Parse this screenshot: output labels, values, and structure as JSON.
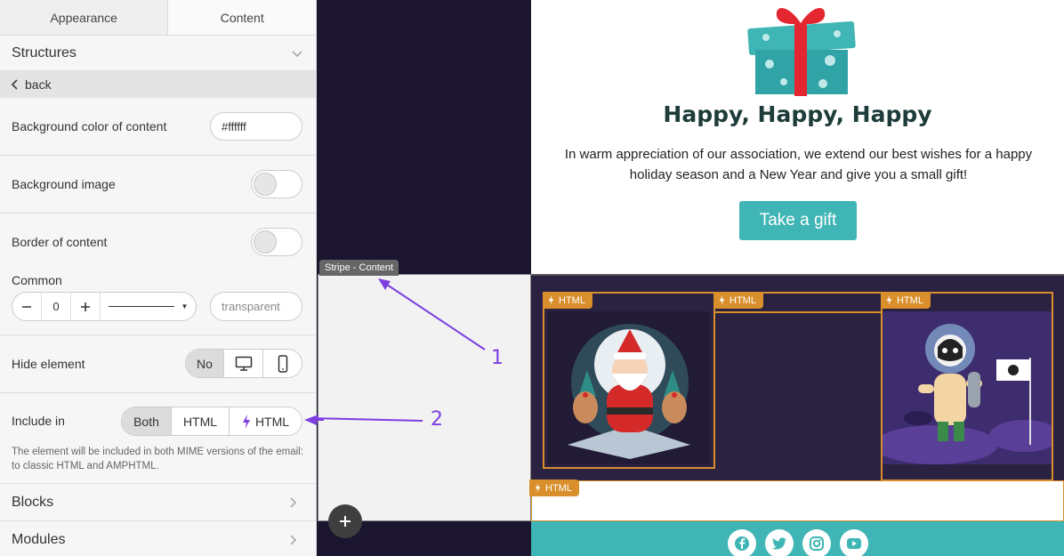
{
  "tabs": {
    "appearance": "Appearance",
    "content": "Content"
  },
  "structures": {
    "title": "Structures"
  },
  "back": {
    "label": "back"
  },
  "bg_color": {
    "label": "Background color of content",
    "value": "#ffffff"
  },
  "bg_image": {
    "label": "Background image"
  },
  "border": {
    "label": "Border of content"
  },
  "common": {
    "label": "Common",
    "width_value": "0",
    "color_value": "transparent"
  },
  "hide": {
    "label": "Hide element",
    "no": "No"
  },
  "include": {
    "label": "Include in",
    "both": "Both",
    "html": "HTML",
    "amp_html": "HTML"
  },
  "include_note": "The element will be included in both MIME versions of the email: to classic HTML and AMPHTML.",
  "nav": {
    "blocks": "Blocks",
    "modules": "Modules"
  },
  "canvas": {
    "stripe_tag": "Stripe - Content",
    "headline": "Happy, Happy, Happy",
    "body": "In warm appreciation of our association, we extend our best wishes for a happy holiday season and a New Year and give you a small gift!",
    "cta": "Take a gift",
    "html_tag": "HTML"
  },
  "annotations": {
    "one": "1",
    "two": "2"
  },
  "colors": {
    "accent": "#3fb5b5",
    "amp_border": "#d98f2b",
    "annotation": "#7d3ee0",
    "dark_bg": "#1b1530"
  },
  "icons": [
    "chevron-down-icon",
    "chevron-left-icon",
    "chevron-right-icon",
    "minus-icon",
    "plus-icon",
    "desktop-icon",
    "mobile-icon",
    "lightning-icon",
    "facebook-icon",
    "twitter-icon",
    "instagram-icon",
    "youtube-icon"
  ]
}
